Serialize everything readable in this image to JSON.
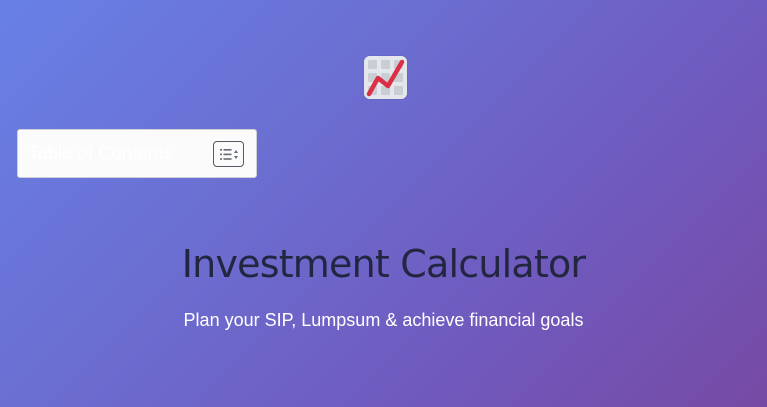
{
  "app_icon": {
    "icon": "chart-increasing-icon",
    "colors": {
      "tile": "#e3e6ea",
      "grid": "#c9ced4",
      "line": "#dc2e45"
    }
  },
  "toc": {
    "title": "Table of Contents",
    "toggle_icon": "list-toggle-icon"
  },
  "hero": {
    "title": "Investment Calculator",
    "subtitle": "Plan your SIP, Lumpsum & achieve financial goals"
  },
  "colors": {
    "background_start": "#6880e6",
    "background_end": "#764aa4",
    "title_text": "#222640",
    "subtitle_text": "#ffffff"
  }
}
